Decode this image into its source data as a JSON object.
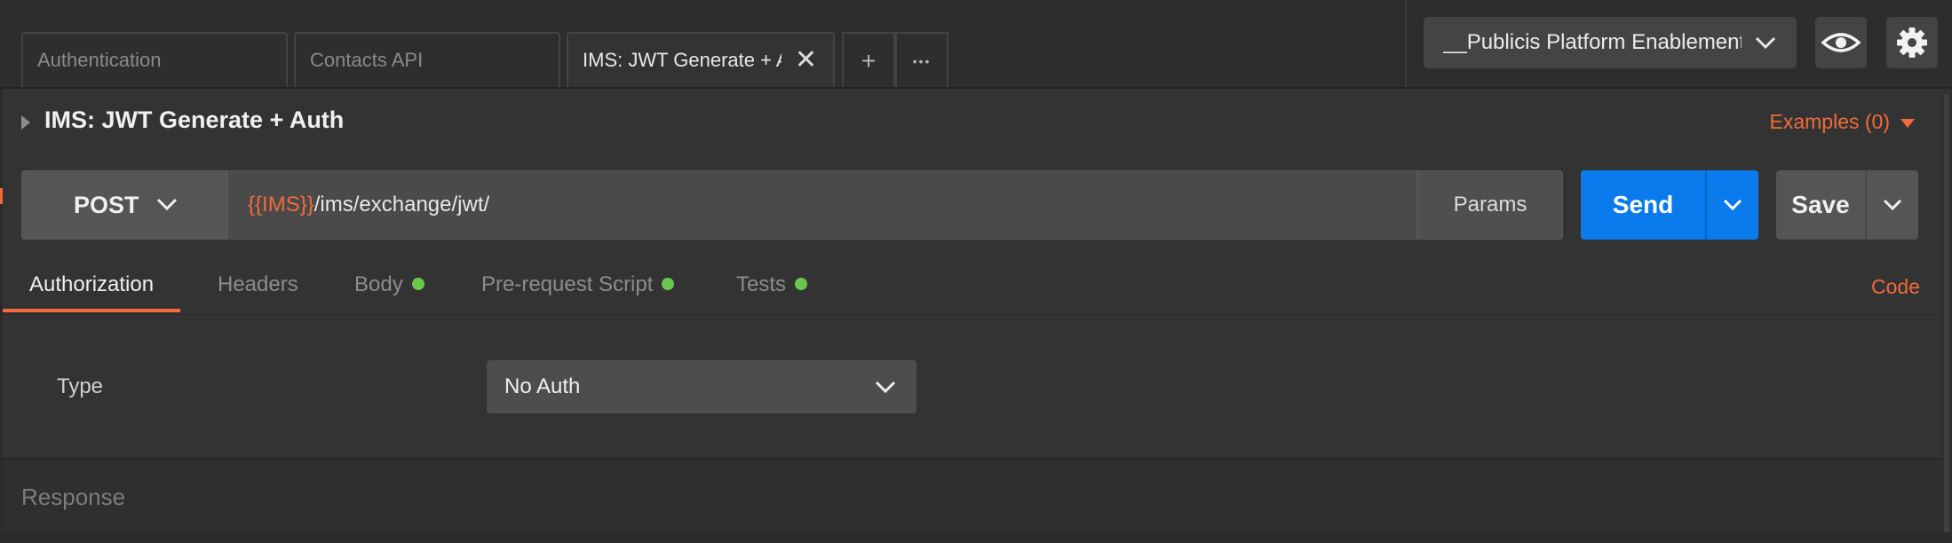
{
  "tabs": [
    {
      "label": "Authentication",
      "active": false
    },
    {
      "label": "Contacts API",
      "active": false
    },
    {
      "label": "IMS: JWT Generate + Auth",
      "active": true
    }
  ],
  "tab_close_glyph": "✕",
  "new_tab_glyph": "+",
  "tab_more_glyph": "•••",
  "environment": {
    "selected": "__Publicis Platform Enablement"
  },
  "icons": {
    "env_quick_look": "eye-icon",
    "settings": "gear-icon",
    "tab_close": "close-icon",
    "new_tab": "plus-icon",
    "more": "more-horizontal-icon"
  },
  "request": {
    "name": "IMS: JWT Generate + Auth",
    "examples_label": "Examples (0)",
    "method": "POST",
    "url_variable": "{{IMS}}",
    "url_path": "/ims/exchange/jwt/",
    "params_label": "Params",
    "send_label": "Send",
    "save_label": "Save"
  },
  "subtabs": [
    {
      "label": "Authorization",
      "active": true,
      "dot": false
    },
    {
      "label": "Headers",
      "active": false,
      "dot": false
    },
    {
      "label": "Body",
      "active": false,
      "dot": true
    },
    {
      "label": "Pre-request Script",
      "active": false,
      "dot": true
    },
    {
      "label": "Tests",
      "active": false,
      "dot": true
    }
  ],
  "code_label": "Code",
  "auth": {
    "type_label": "Type",
    "type_value": "No Auth"
  },
  "response": {
    "label": "Response"
  },
  "colors": {
    "accent": "#f26b3a",
    "send_blue": "#097bed",
    "indicator_green": "#6bc74c",
    "background": "#333333"
  }
}
